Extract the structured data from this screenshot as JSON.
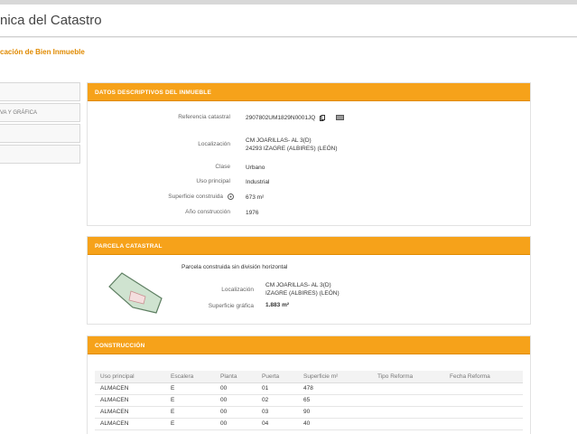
{
  "header": {
    "title": "nica del Catastro"
  },
  "page": {
    "heading": "cación de Bien Inmueble"
  },
  "sidebar": {
    "items": [
      {
        "label": ""
      },
      {
        "label": "VA Y GRÁFICA"
      },
      {
        "label": ""
      },
      {
        "label": ""
      }
    ]
  },
  "datos": {
    "title": "DATOS DESCRIPTIVOS DEL INMUEBLE",
    "referencia": {
      "label": "Referencia catastral",
      "value": "2907802UM1829N0001JQ"
    },
    "localizacion": {
      "label": "Localización",
      "line1": "CM JOARILLAS- AL 3(D)",
      "line2": "24293 IZAGRE (ALBIRES) (LEÓN)"
    },
    "clase": {
      "label": "Clase",
      "value": "Urbano"
    },
    "uso": {
      "label": "Uso principal",
      "value": "Industrial"
    },
    "superficie": {
      "label": "Superficie construida",
      "value": "673 m²"
    },
    "anio": {
      "label": "Año construcción",
      "value": "1976"
    }
  },
  "parcela": {
    "title": "PARCELA CATASTRAL",
    "subtitle": "Parcela construida sin división horizontal",
    "localizacion": {
      "label": "Localización",
      "line1": "CM JOARILLAS- AL 3(D)",
      "line2": "IZAGRE (ALBIRES) (LEÓN)"
    },
    "superficie": {
      "label": "Superficie gráfica",
      "value": "1.883 m²"
    }
  },
  "construccion": {
    "title": "CONSTRUCCIÓN",
    "columns": [
      "Uso principal",
      "Escalera",
      "Planta",
      "Puerta",
      "Superficie m²",
      "Tipo Reforma",
      "Fecha Reforma"
    ],
    "rows": [
      [
        "ALMACEN",
        "E",
        "00",
        "01",
        "478",
        "",
        ""
      ],
      [
        "ALMACEN",
        "E",
        "00",
        "02",
        "65",
        "",
        ""
      ],
      [
        "ALMACEN",
        "E",
        "00",
        "03",
        "90",
        "",
        ""
      ],
      [
        "ALMACEN",
        "E",
        "00",
        "04",
        "40",
        "",
        ""
      ]
    ]
  },
  "colors": {
    "accent": "#f6a21a",
    "heading": "#e08a00"
  }
}
